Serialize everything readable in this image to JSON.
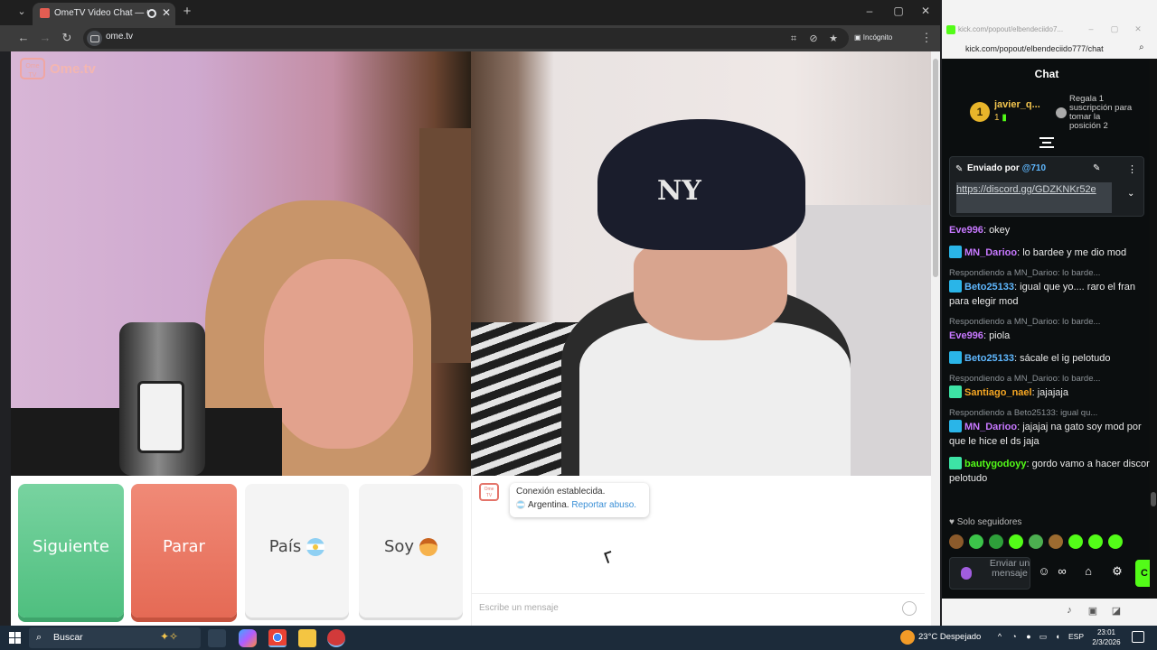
{
  "browser": {
    "tab_title": "OmeTV Video Chat — Ome",
    "url": "ome.tv",
    "incognito_label": "Incógnito"
  },
  "ometv": {
    "logo_text": "Ome.tv",
    "buttons": {
      "next": "Siguiente",
      "stop": "Parar",
      "country": "País",
      "gender": "Soy"
    },
    "system_message": {
      "line1": "Conexión establecida.",
      "country": "Argentina.",
      "report_link": "Reportar abuso."
    },
    "input_placeholder": "Escribe un mensaje"
  },
  "kick": {
    "tab_title": "kick.com/popout/elbendeciido7...",
    "url": "kick.com/popout/elbendeciido777/chat",
    "chat_title": "Chat",
    "leaderboard": {
      "rank": "1",
      "name": "javier_q...",
      "subs": "1",
      "gift_text": "Regala 1 suscripción para tomar la posición 2"
    },
    "pinned": {
      "label": "Enviado por",
      "user": "@710",
      "link": "https://discord.gg/GDZKNKr52e"
    },
    "messages": [
      {
        "reply": "",
        "user": "Eve996",
        "badge": "",
        "color": "#c778ff",
        "text": "okey"
      },
      {
        "reply": "",
        "user": "MN_Darioo",
        "badge": "mod",
        "color": "#c778ff",
        "text": "lo bardee y me dio mod"
      },
      {
        "reply": "Respondiendo a MN_Darioo: lo barde...",
        "user": "Beto25133",
        "badge": "mod",
        "color": "#5fb8ff",
        "text": "igual que yo.... raro el fran para elegir mod"
      },
      {
        "reply": "Respondiendo a MN_Darioo: lo barde...",
        "user": "Eve996",
        "badge": "",
        "color": "#c778ff",
        "text": "piola"
      },
      {
        "reply": "",
        "user": "Beto25133",
        "badge": "mod",
        "color": "#5fb8ff",
        "text": "sácale el ig pelotudo"
      },
      {
        "reply": "Respondiendo a MN_Darioo: lo barde...",
        "user": "Santiago_nael",
        "badge": "vip",
        "color": "#f5a623",
        "text": "jajajaja"
      },
      {
        "reply": "Respondiendo a Beto25133: igual qu...",
        "user": "MN_Darioo",
        "badge": "mod",
        "color": "#c778ff",
        "text": "jajajaj na gato soy mod por que le hice el ds jaja"
      },
      {
        "reply": "",
        "user": "bautygodoyy",
        "badge": "vip",
        "color": "#53fc18",
        "text": "gordo vamo a hacer discor pelotudo"
      }
    ],
    "followers_only": "Solo seguidores",
    "send_placeholder": "Enviar un mensaje",
    "chat_button": "C"
  },
  "taskbar": {
    "search_placeholder": "Buscar",
    "weather": "23°C  Despejado",
    "language": "ESP",
    "time": "23:01",
    "date": "2/3/2026"
  }
}
